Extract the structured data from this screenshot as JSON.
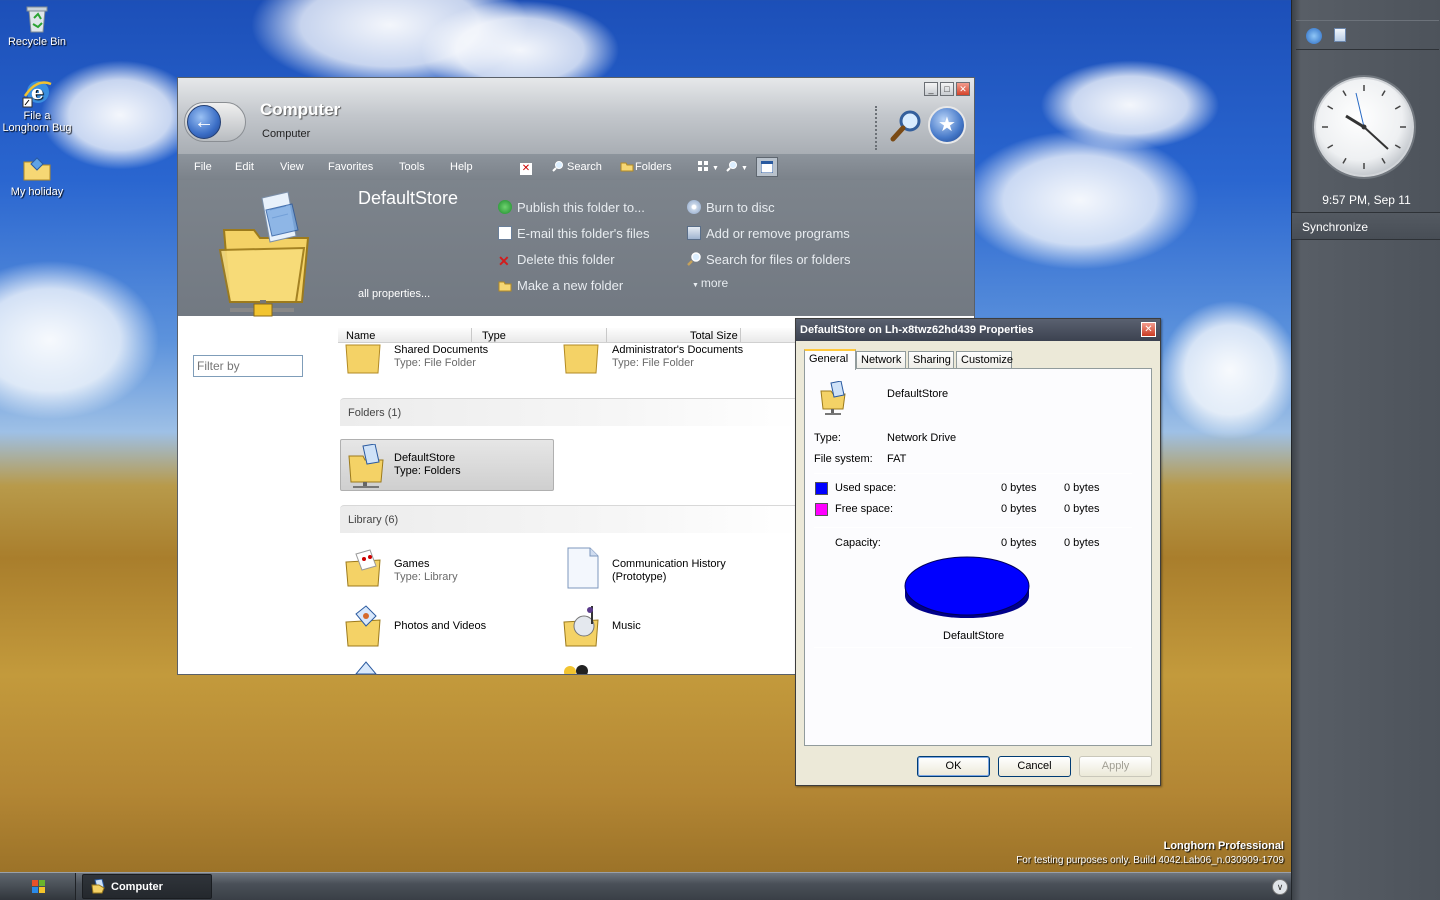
{
  "desktop": {
    "icons": [
      {
        "label": "Recycle Bin"
      },
      {
        "label": "File a Longhorn Bug"
      },
      {
        "label": "My holiday"
      }
    ],
    "watermark_line1": "Longhorn Professional",
    "watermark_line2": "For testing purposes only. Build 4042.Lab06_n.030909-1709"
  },
  "explorer": {
    "title": "Computer",
    "subtitle": "Computer",
    "menu": [
      "File",
      "Edit",
      "View",
      "Favorites",
      "Tools",
      "Help"
    ],
    "toolbar": {
      "search": "Search",
      "folders": "Folders"
    },
    "tasks": {
      "store_name": "DefaultStore",
      "all_properties": "all properties...",
      "left": [
        "Publish this folder to...",
        "E-mail this folder's files",
        "Delete this folder",
        "Make a new folder"
      ],
      "right": [
        "Burn to disc",
        "Add or remove programs",
        "Search for files or folders"
      ],
      "more": "more"
    },
    "filter_placeholder": "Filter by",
    "columns": [
      "Name",
      "Type",
      "Total Size"
    ],
    "top_items": [
      {
        "name": "Shared Documents",
        "type": "Type: File Folder"
      },
      {
        "name": "Administrator's Documents",
        "type": "Type: File Folder"
      }
    ],
    "groups": {
      "folders": "Folders (1)",
      "library": "Library (6)"
    },
    "folder_item": {
      "name": "DefaultStore",
      "type": "Type: Folders"
    },
    "library_items": [
      {
        "name": "Games",
        "type": "Type: Library"
      },
      {
        "name": "Communication History",
        "type": "(Prototype)"
      },
      {
        "name": "Photos and Videos",
        "type": ""
      },
      {
        "name": "Music",
        "type": ""
      }
    ]
  },
  "properties": {
    "title": "DefaultStore on Lh-x8twz62hd439 Properties",
    "tabs": [
      "General",
      "Network",
      "Sharing",
      "Customize"
    ],
    "name": "DefaultStore",
    "type_label": "Type:",
    "type_value": "Network Drive",
    "fs_label": "File system:",
    "fs_value": "FAT",
    "used_label": "Used space:",
    "used_bytes": "0 bytes",
    "used_bytes2": "0 bytes",
    "free_label": "Free space:",
    "free_bytes": "0 bytes",
    "free_bytes2": "0 bytes",
    "capacity_label": "Capacity:",
    "capacity_bytes": "0 bytes",
    "capacity_bytes2": "0 bytes",
    "pie_label": "DefaultStore",
    "used_color": "#0000ff",
    "free_color": "#ff00ff",
    "buttons": {
      "ok": "OK",
      "cancel": "Cancel",
      "apply": "Apply"
    }
  },
  "sidebar": {
    "time": "9:57 PM, Sep 11",
    "sync": "Synchronize"
  },
  "taskbar": {
    "task": "Computer"
  }
}
